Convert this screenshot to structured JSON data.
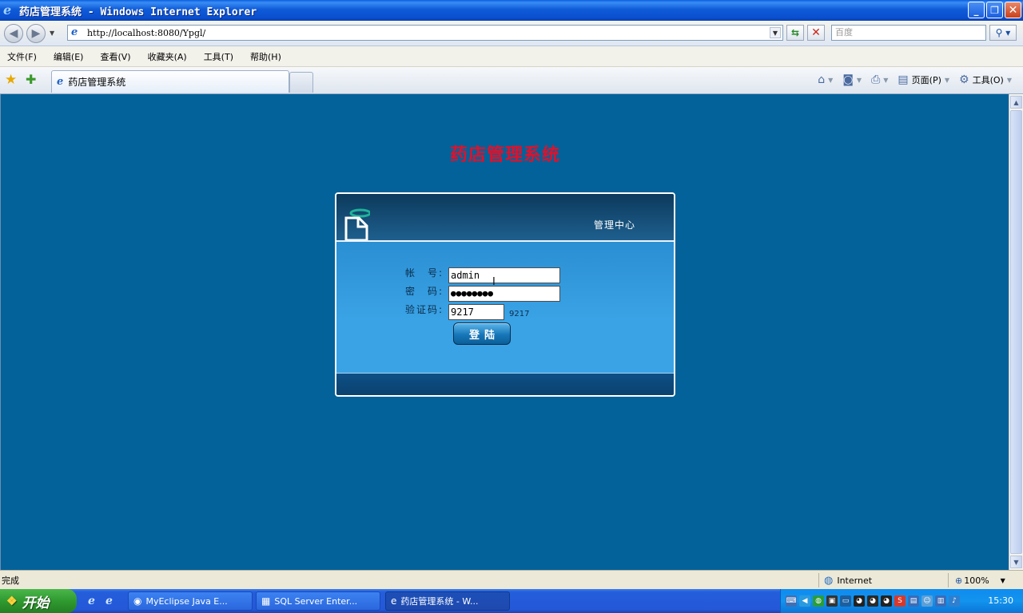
{
  "window": {
    "title": "药店管理系统 - Windows Internet Explorer",
    "min": "_",
    "max": "❐",
    "close": "✕"
  },
  "address": {
    "url": "http://localhost:8080/Ypgl/",
    "search_placeholder": "百度"
  },
  "menu": [
    "文件(F)",
    "编辑(E)",
    "查看(V)",
    "收藏夹(A)",
    "工具(T)",
    "帮助(H)"
  ],
  "tab": {
    "label": "药店管理系统"
  },
  "command_bar": {
    "page_label": "页面(P)",
    "tools_label": "工具(O)"
  },
  "page": {
    "title": "药店管理系统",
    "header_label": "管理中心",
    "username_label": "帐　号:",
    "password_label": "密　码:",
    "captcha_label": "验证码:",
    "username_value": "admin",
    "password_value": "●●●●●●●●",
    "captcha_value": "9217",
    "captcha_code": "9217",
    "login_button": "登陆"
  },
  "status": {
    "text": "完成",
    "zone": "Internet",
    "zoom": "100%"
  },
  "taskbar": {
    "start": "开始",
    "tasks": [
      "MyEclipse Java E...",
      "SQL Server Enter...",
      "药店管理系统 - W..."
    ],
    "clock": "15:30"
  },
  "colors": {
    "page_background": "#03629A",
    "title_red": "#E2102A",
    "panel_blue": "#2A8FD2",
    "panel_dark": "#0C3A5C"
  }
}
